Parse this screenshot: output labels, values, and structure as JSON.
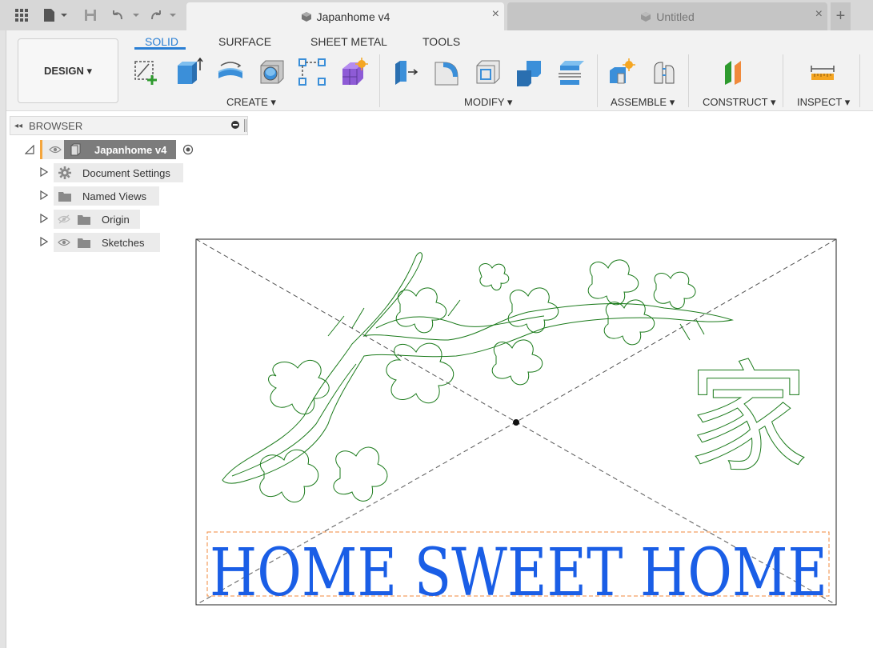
{
  "titlebar": {
    "active_tab": "Japanhome v4",
    "inactive_tab": "Untitled",
    "close_symbol": "×",
    "new_tab_symbol": "+"
  },
  "toolbar": {
    "workspace": "DESIGN ▾",
    "tabs": [
      {
        "label": "SOLID",
        "active": true
      },
      {
        "label": "SURFACE",
        "active": false
      },
      {
        "label": "SHEET METAL",
        "active": false
      },
      {
        "label": "TOOLS",
        "active": false
      }
    ],
    "groups": {
      "create": "CREATE ▾",
      "modify": "MODIFY ▾",
      "assemble": "ASSEMBLE ▾",
      "construct": "CONSTRUCT ▾",
      "inspect": "INSPECT ▾"
    }
  },
  "browser": {
    "title": "BROWSER",
    "root": "Japanhome v4",
    "items": [
      {
        "label": "Document Settings",
        "icon": "gear-icon"
      },
      {
        "label": "Named Views",
        "icon": "folder-icon"
      },
      {
        "label": "Origin",
        "icon": "folder-icon",
        "hidden": true
      },
      {
        "label": "Sketches",
        "icon": "folder-icon"
      }
    ]
  },
  "canvas": {
    "sketch_text": "HOME SWEET HOME",
    "kanji": "家"
  },
  "colors": {
    "accent": "#2a7fd4",
    "sketch_profile": "#1a7a1a",
    "text_fill": "#1a5ee6",
    "selection_box": "#f08a3c"
  }
}
